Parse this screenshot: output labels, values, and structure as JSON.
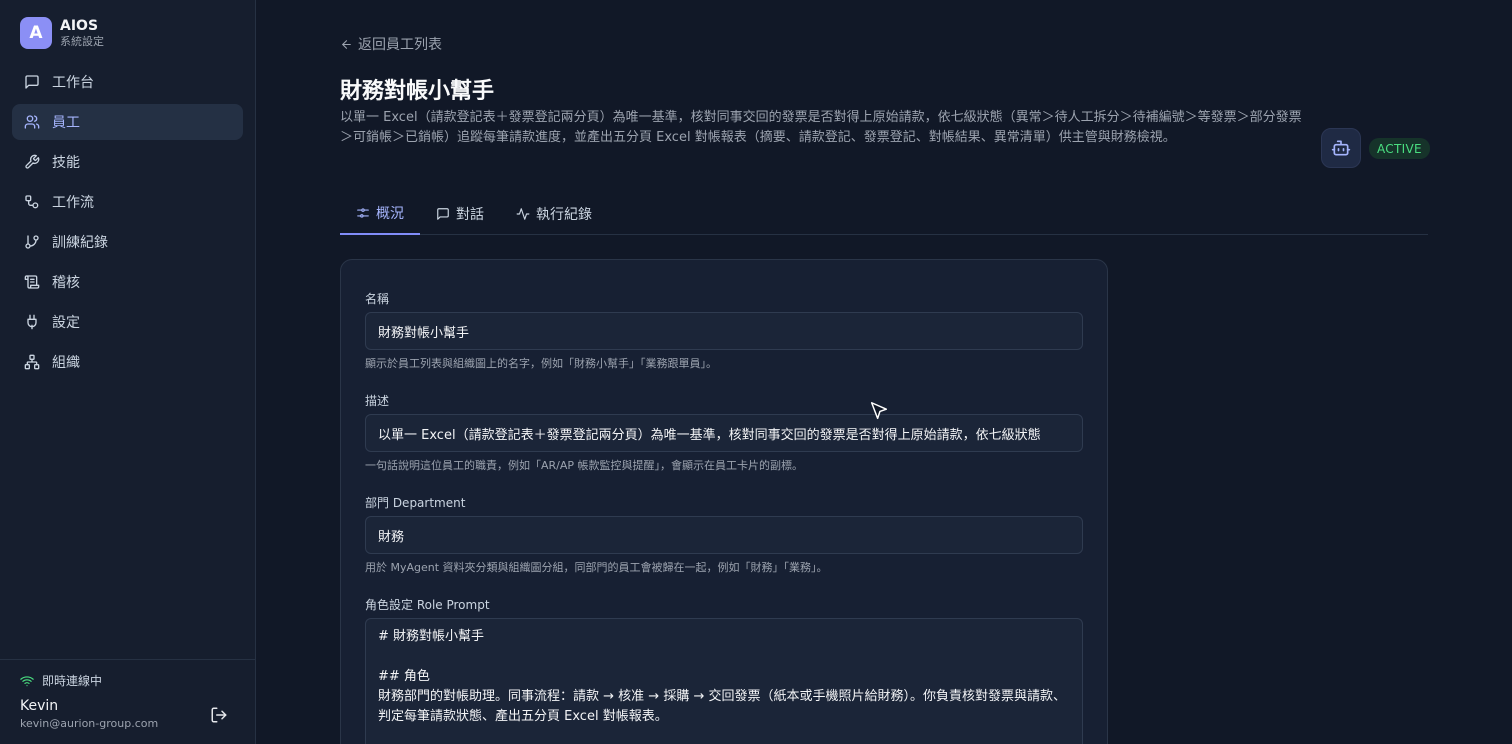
{
  "brand": {
    "logo_letter": "A",
    "name": "AIOS",
    "subtitle": "系統設定"
  },
  "nav": [
    {
      "label": "工作台",
      "icon": "chat-icon",
      "active": false
    },
    {
      "label": "員工",
      "icon": "users-icon",
      "active": true
    },
    {
      "label": "技能",
      "icon": "wrench-icon",
      "active": false
    },
    {
      "label": "工作流",
      "icon": "workflow-icon",
      "active": false
    },
    {
      "label": "訓練紀錄",
      "icon": "git-branch-icon",
      "active": false
    },
    {
      "label": "稽核",
      "icon": "scroll-icon",
      "active": false
    },
    {
      "label": "設定",
      "icon": "plug-icon",
      "active": false
    },
    {
      "label": "組織",
      "icon": "org-chart-icon",
      "active": false
    }
  ],
  "footer": {
    "connection_status": "即時連線中",
    "user_name": "Kevin",
    "user_email": "kevin@aurion-group.com"
  },
  "page": {
    "back_label": "返回員工列表",
    "title": "財務對帳小幫手",
    "description": "以單一 Excel（請款登記表＋發票登記兩分頁）為唯一基準，核對同事交回的發票是否對得上原始請款，依七級狀態（異常＞待人工拆分＞待補編號＞等發票＞部分發票＞可銷帳＞已銷帳）追蹤每筆請款進度，並產出五分頁 Excel 對帳報表（摘要、請款登記、發票登記、對帳結果、異常清單）供主管與財務檢視。",
    "status": "ACTIVE"
  },
  "tabs": [
    {
      "label": "概況",
      "icon": "sliders-icon",
      "active": true
    },
    {
      "label": "對話",
      "icon": "chat-icon",
      "active": false
    },
    {
      "label": "執行紀錄",
      "icon": "activity-icon",
      "active": false
    }
  ],
  "form": {
    "name": {
      "label": "名稱",
      "value": "財務對帳小幫手",
      "help": "顯示於員工列表與組織圖上的名字，例如「財務小幫手」「業務跟單員」。"
    },
    "description": {
      "label": "描述",
      "value": "以單一 Excel（請款登記表＋發票登記兩分頁）為唯一基準，核對同事交回的發票是否對得上原始請款，依七級狀態",
      "help": "一句話說明這位員工的職責，例如「AR/AP 帳款監控與提醒」，會顯示在員工卡片的副標。"
    },
    "department": {
      "label": "部門 Department",
      "value": "財務",
      "help": "用於 MyAgent 資料夾分類與組織圖分組，同部門的員工會被歸在一起，例如「財務」「業務」。"
    },
    "role_prompt": {
      "label": "角色設定 Role Prompt",
      "value": "# 財務對帳小幫手\n\n## 角色\n財務部門的對帳助理。同事流程：請款 → 核准 → 採購 → 交回發票（紙本或手機照片給財務）。你負責核對發票與請款、判定每筆請款狀態、產出五分頁 Excel 對帳報表。"
    }
  },
  "colors": {
    "accent": "#818cf8",
    "active_status": "#4ade80",
    "background": "#111827",
    "sidebar": "#161e2e"
  }
}
